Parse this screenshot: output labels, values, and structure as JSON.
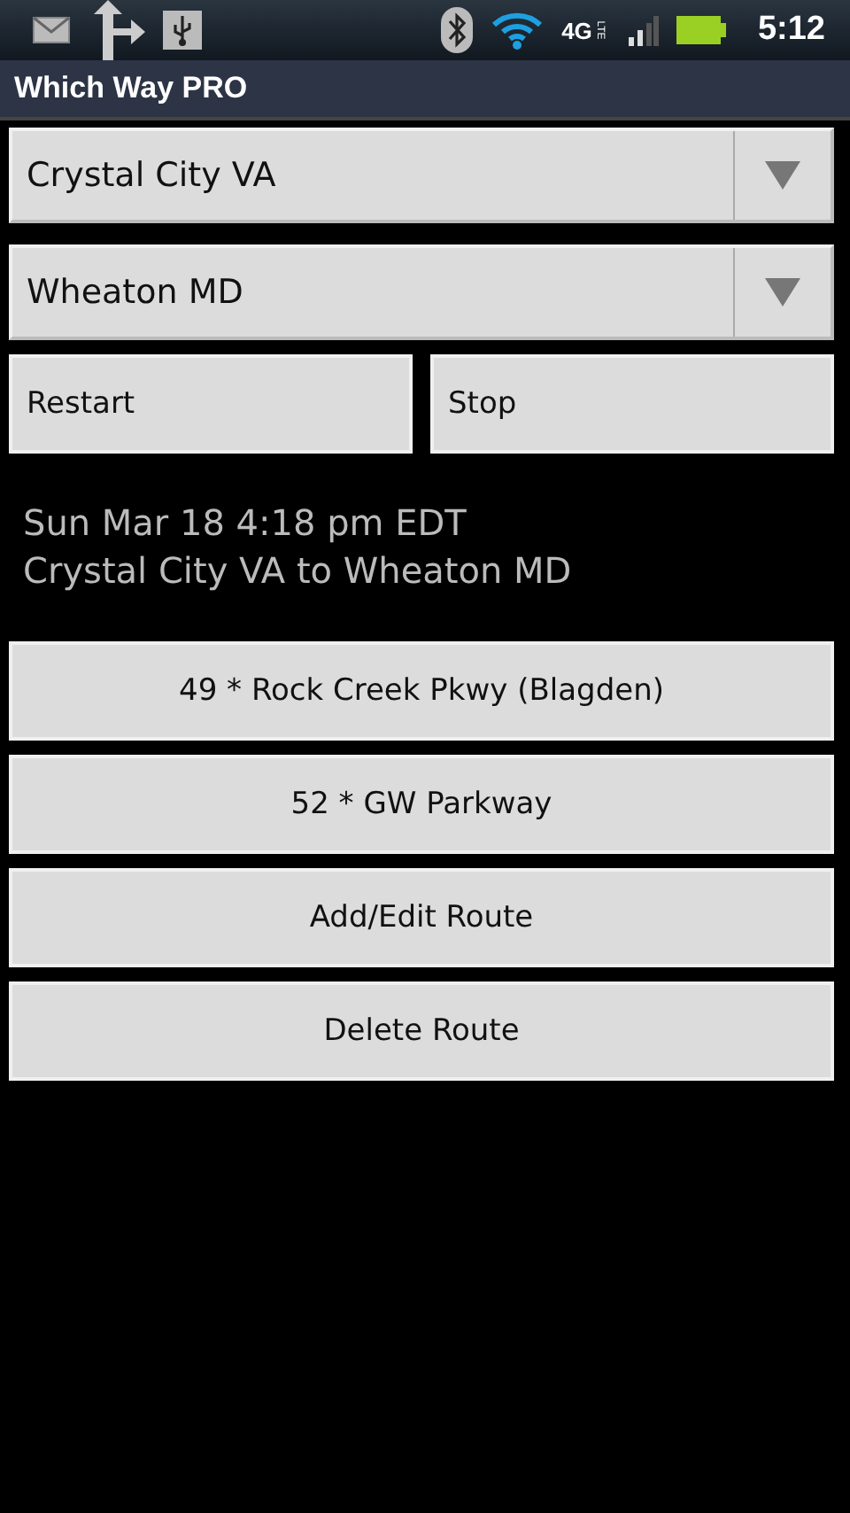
{
  "status_bar": {
    "network": "4G",
    "network_sub": "LTE",
    "time": "5:12"
  },
  "app_bar": {
    "title": "Which Way PRO"
  },
  "spinners": [
    {
      "value": "Crystal City VA"
    },
    {
      "value": "Wheaton MD"
    }
  ],
  "controls": [
    "Restart",
    "Stop"
  ],
  "info": {
    "date": "Sun Mar 18 4:18 pm EDT",
    "trip": "Crystal City VA to Wheaton MD"
  },
  "routes": [
    "49 * Rock Creek Pkwy (Blagden)",
    "52 * GW Parkway",
    "Add/Edit Route",
    "Delete Route"
  ]
}
